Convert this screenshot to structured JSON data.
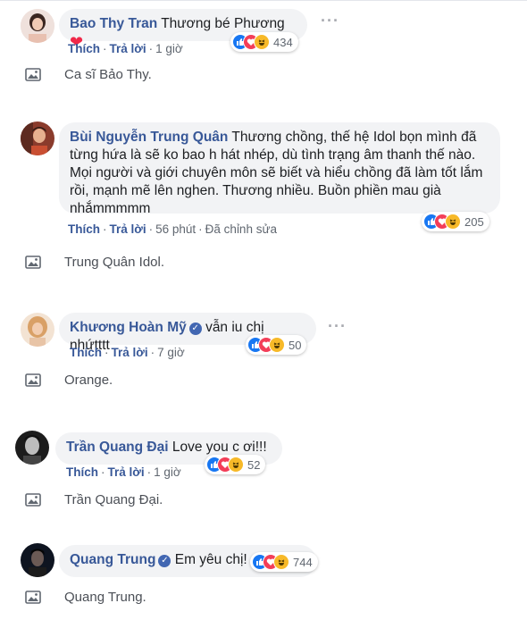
{
  "comments": [
    {
      "name": "Bao Thy Tran",
      "text": "Thương bé Phương",
      "has_heart": true,
      "verified": false,
      "actions": [
        "Thích",
        "Trả lời",
        "1 giờ"
      ],
      "reaction_count": "434",
      "caption": "Ca sĩ Bảo Thy."
    },
    {
      "name": "Bùi Nguyễn Trung Quân",
      "text": "Thương chồng, thế hệ Idol bọn mình đã từng hứa là sẽ ko bao h hát nhép, dù tình trạng âm thanh thế nào. Mọi người và giới chuyên môn sẽ biết và hiểu chồng đã làm tốt lắm rồi, mạnh mẽ lên nghen. Thương nhiều. Buồn phiền mau già nhắmmmmm",
      "verified": false,
      "actions": [
        "Thích",
        "Trả lời",
        "56 phút",
        "Đã chỉnh sửa"
      ],
      "reaction_count": "205",
      "caption": "Trung Quân Idol."
    },
    {
      "name": "Khương Hoàn Mỹ",
      "text": "vẫn iu chị nhứtttt",
      "verified": true,
      "actions": [
        "Thích",
        "Trả lời",
        "7 giờ"
      ],
      "reaction_count": "50",
      "caption": "Orange."
    },
    {
      "name": "Trần Quang Đại",
      "text": "Love you c ơi!!!",
      "verified": false,
      "actions": [
        "Thích",
        "Trả lời",
        "1 giờ"
      ],
      "reaction_count": "52",
      "caption": "Trần Quang Đại."
    },
    {
      "name": "Quang Trung",
      "text": "Em yêu chị!",
      "verified": true,
      "actions": [],
      "reaction_count": "744",
      "caption": "Quang Trung."
    }
  ],
  "icons": {
    "more": "more-options-icon",
    "reaction_like": "like-reaction-icon",
    "reaction_love": "love-reaction-icon",
    "reaction_haha": "haha-reaction-icon",
    "caption_image": "image-icon"
  },
  "colors": {
    "name": "#385898",
    "bubble": "#f2f3f5",
    "like": "#1877f2",
    "love": "#f33e58",
    "haha": "#f7b928"
  }
}
